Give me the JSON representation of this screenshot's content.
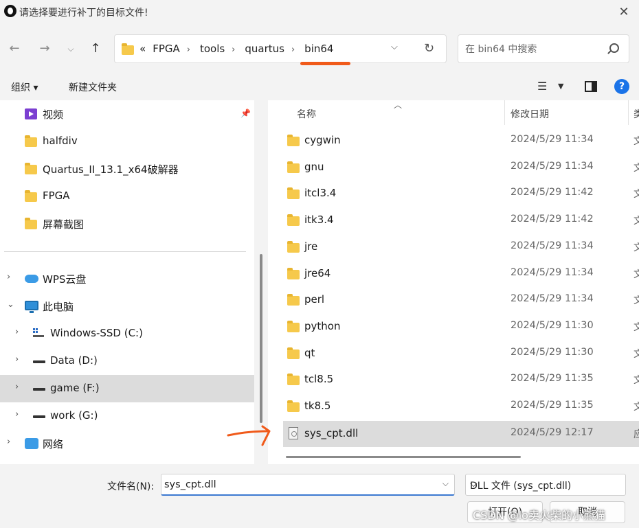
{
  "window": {
    "title": "请选择要进行补丁的目标文件!"
  },
  "nav": {
    "breadcrumbs": [
      "«",
      "FPGA",
      "tools",
      "quartus",
      "bin64"
    ],
    "search_placeholder": "在 bin64 中搜索"
  },
  "toolbar": {
    "organize": "组织 ▾",
    "new_folder": "新建文件夹"
  },
  "sidebar": {
    "quick_access": [
      {
        "label": "视频",
        "icon": "video-icon",
        "pinned": true
      },
      {
        "label": "halfdiv",
        "icon": "folder-icon"
      },
      {
        "label": "Quartus_II_13.1_x64破解器",
        "icon": "folder-icon"
      },
      {
        "label": "FPGA",
        "icon": "folder-icon"
      },
      {
        "label": "屏幕截图",
        "icon": "folder-icon"
      }
    ],
    "tree": [
      {
        "label": "WPS云盘",
        "icon": "cloud-icon"
      },
      {
        "label": "此电脑",
        "icon": "computer-icon",
        "expanded": true
      },
      {
        "label": "Windows-SSD (C:)",
        "icon": "windows-drive-icon"
      },
      {
        "label": "Data (D:)",
        "icon": "drive-icon"
      },
      {
        "label": "game (F:)",
        "icon": "drive-icon",
        "selected": true
      },
      {
        "label": "work (G:)",
        "icon": "drive-icon"
      },
      {
        "label": "网络",
        "icon": "network-icon"
      }
    ]
  },
  "files": {
    "columns": {
      "name": "名称",
      "date": "修改日期",
      "type": "类"
    },
    "rows": [
      {
        "name": "cygwin",
        "date": "2024/5/29 11:34",
        "type": "文",
        "kind": "folder"
      },
      {
        "name": "gnu",
        "date": "2024/5/29 11:34",
        "type": "文",
        "kind": "folder"
      },
      {
        "name": "itcl3.4",
        "date": "2024/5/29 11:42",
        "type": "文",
        "kind": "folder"
      },
      {
        "name": "itk3.4",
        "date": "2024/5/29 11:42",
        "type": "文",
        "kind": "folder"
      },
      {
        "name": "jre",
        "date": "2024/5/29 11:34",
        "type": "文",
        "kind": "folder"
      },
      {
        "name": "jre64",
        "date": "2024/5/29 11:34",
        "type": "文",
        "kind": "folder"
      },
      {
        "name": "perl",
        "date": "2024/5/29 11:34",
        "type": "文",
        "kind": "folder"
      },
      {
        "name": "python",
        "date": "2024/5/29 11:30",
        "type": "文",
        "kind": "folder"
      },
      {
        "name": "qt",
        "date": "2024/5/29 11:30",
        "type": "文",
        "kind": "folder"
      },
      {
        "name": "tcl8.5",
        "date": "2024/5/29 11:35",
        "type": "文",
        "kind": "folder"
      },
      {
        "name": "tk8.5",
        "date": "2024/5/29 11:35",
        "type": "文",
        "kind": "folder"
      },
      {
        "name": "sys_cpt.dll",
        "date": "2024/5/29 12:17",
        "type": "应",
        "kind": "file",
        "selected": true
      }
    ]
  },
  "footer": {
    "filename_label": "文件名(N):",
    "filename_value": "sys_cpt.dll",
    "filetype": "DLL 文件 (sys_cpt.dll)",
    "open_label": "打开(O)",
    "cancel_label": "取消"
  },
  "watermark": "CSDN @lo卖火柴的小熊猫",
  "colors": {
    "accent": "#1a73e8",
    "annotation": "#f05a1a",
    "selection": "#dcdcdc",
    "folder": "#f6c94b"
  }
}
